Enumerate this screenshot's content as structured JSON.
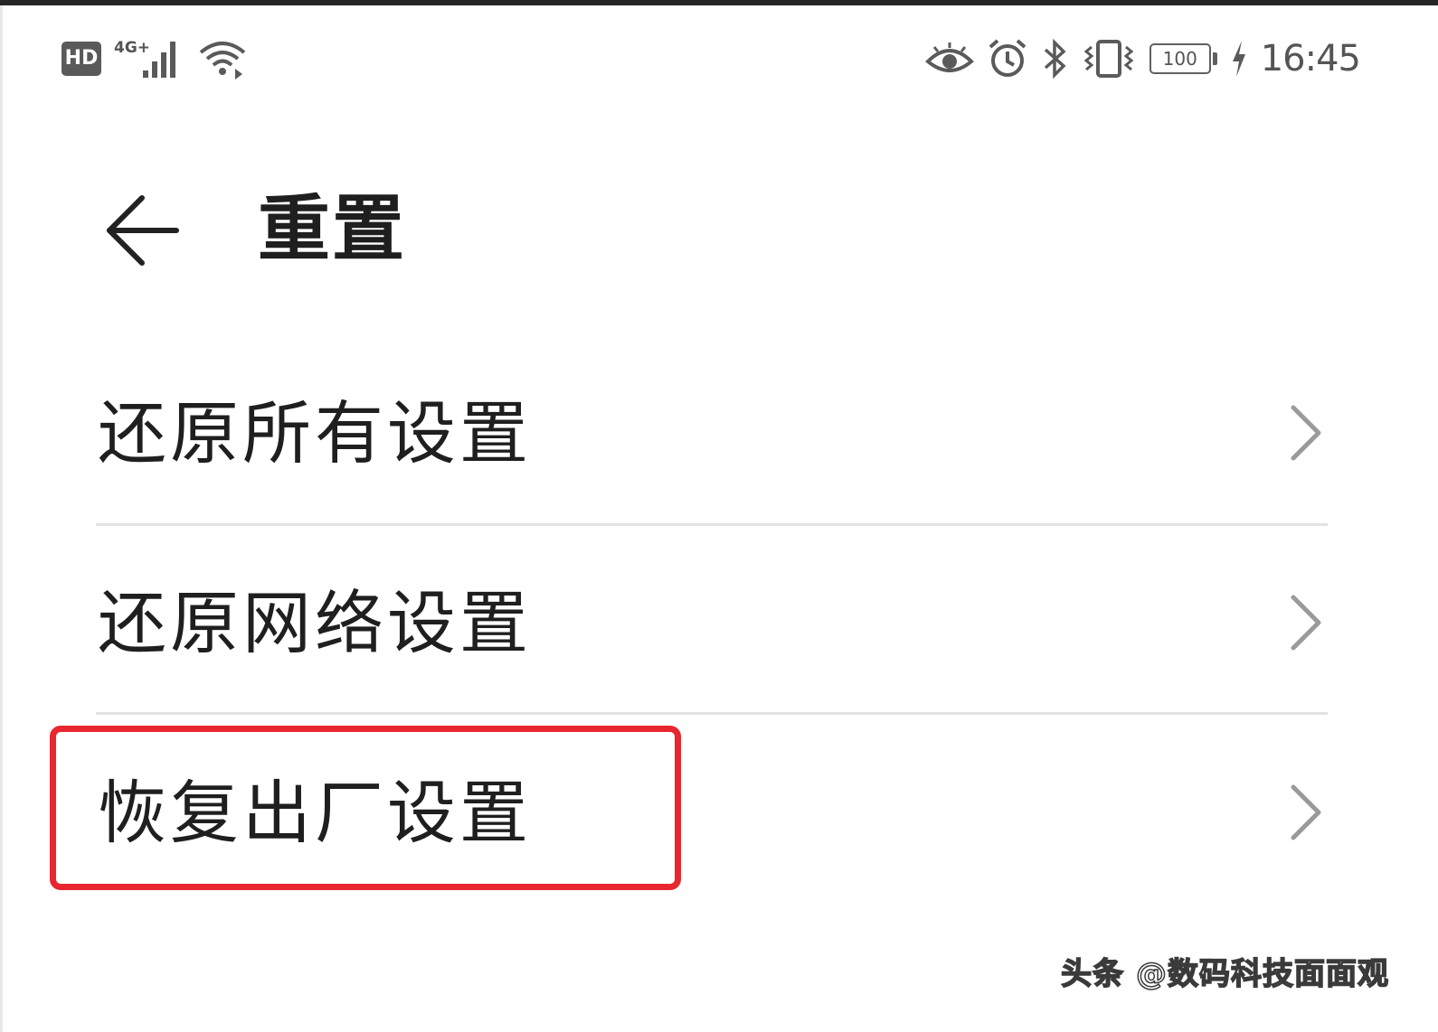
{
  "status_bar": {
    "hd_badge": "HD",
    "network_type": "4G+",
    "battery_level": "100",
    "time": "16:45",
    "left_icons": [
      "hd-icon",
      "signal-icon",
      "wifi-icon"
    ],
    "right_icons": [
      "eye-comfort-icon",
      "alarm-icon",
      "bluetooth-icon",
      "vibrate-icon",
      "battery-icon",
      "charging-icon"
    ]
  },
  "header": {
    "title": "重置",
    "back_icon": "back-arrow-icon"
  },
  "settings": {
    "items": [
      {
        "label": "还原所有设置",
        "icon": "chevron-right-icon"
      },
      {
        "label": "还原网络设置",
        "icon": "chevron-right-icon"
      },
      {
        "label": "恢复出厂设置",
        "icon": "chevron-right-icon",
        "highlighted": true
      }
    ]
  },
  "highlight_color": "#e8262f",
  "watermark": "头条 @数码科技面面观"
}
